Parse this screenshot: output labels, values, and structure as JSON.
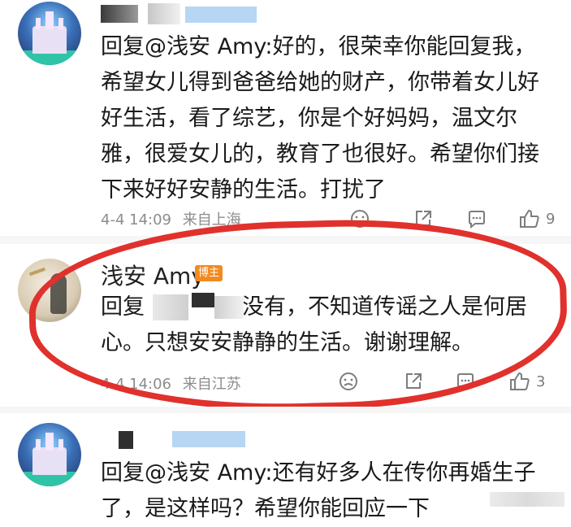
{
  "comments": [
    {
      "reply_prefix": "回复",
      "mention": "@浅安 Amy",
      "text_lines": [
        ":好的，很荣幸你能回复我，",
        "希望女儿得到爸爸给她的财产，你带着女儿好",
        "好生活，看了综艺，你是个好妈妈，温文尔",
        "雅，很爱女儿的，教育了也很好。希望你们接",
        "下来好好安静的生活。打扰了"
      ],
      "time": "4-4 14:09",
      "location": "来自上海",
      "like_count": "9"
    },
    {
      "username": "浅安 Amy",
      "badge": "博主",
      "reply_prefix": "回复",
      "line1_rest": "没有，不知道传谣之人是何居",
      "line2": "心。只想安安静静的生活。谢谢理解。",
      "time": "4-4 14:06",
      "location": "来自江苏",
      "like_count": "3"
    },
    {
      "reply_prefix": "回复",
      "mention": "@浅安 Amy",
      "text_lines": [
        ":还有好多人在传你再婚生子",
        "了，是这样吗？希望你能回应一下"
      ]
    }
  ],
  "colors": {
    "highlight_ring": "#e0312d",
    "badge": "#f28a1f",
    "meta_text": "#8c8c8c"
  },
  "icons": [
    "dislike-icon",
    "repost-icon",
    "comment-icon",
    "like-icon"
  ]
}
